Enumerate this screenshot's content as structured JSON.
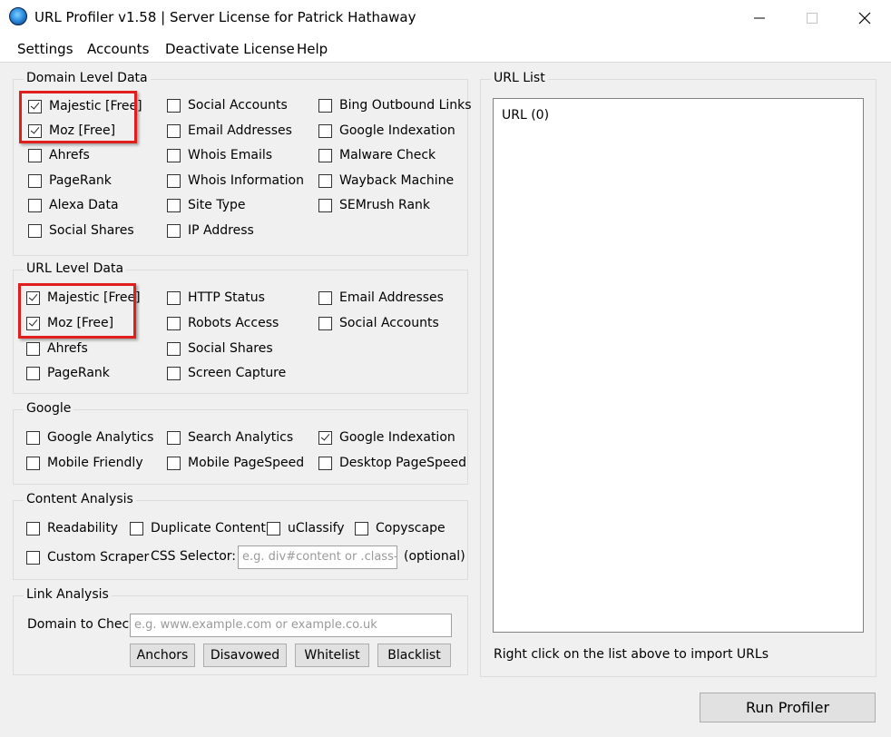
{
  "window": {
    "title": "URL Profiler v1.58 | Server License for Patrick Hathaway"
  },
  "menu": [
    "Settings",
    "Accounts",
    "Deactivate License",
    "Help"
  ],
  "domain_level": {
    "title": "Domain Level Data",
    "items": [
      {
        "label": "Majestic [Free]",
        "checked": true
      },
      {
        "label": "Moz [Free]",
        "checked": true
      },
      {
        "label": "Ahrefs",
        "checked": false
      },
      {
        "label": "PageRank",
        "checked": false
      },
      {
        "label": "Alexa Data",
        "checked": false
      },
      {
        "label": "Social Shares",
        "checked": false
      },
      {
        "label": "Social Accounts",
        "checked": false
      },
      {
        "label": "Email Addresses",
        "checked": false
      },
      {
        "label": "Whois Emails",
        "checked": false
      },
      {
        "label": "Whois Information",
        "checked": false
      },
      {
        "label": "Site Type",
        "checked": false
      },
      {
        "label": "IP Address",
        "checked": false
      },
      {
        "label": "Bing Outbound Links",
        "checked": false
      },
      {
        "label": "Google Indexation",
        "checked": false
      },
      {
        "label": "Malware Check",
        "checked": false
      },
      {
        "label": "Wayback Machine",
        "checked": false
      },
      {
        "label": "SEMrush Rank",
        "checked": false
      }
    ]
  },
  "url_level": {
    "title": "URL Level Data",
    "items": [
      {
        "label": "Majestic [Free]",
        "checked": true
      },
      {
        "label": "Moz [Free]",
        "checked": true
      },
      {
        "label": "Ahrefs",
        "checked": false
      },
      {
        "label": "PageRank",
        "checked": false
      },
      {
        "label": "HTTP Status",
        "checked": false
      },
      {
        "label": "Robots Access",
        "checked": false
      },
      {
        "label": "Social Shares",
        "checked": false
      },
      {
        "label": "Screen Capture",
        "checked": false
      },
      {
        "label": "Email Addresses",
        "checked": false
      },
      {
        "label": "Social Accounts",
        "checked": false
      }
    ]
  },
  "google": {
    "title": "Google",
    "items": [
      {
        "label": "Google Analytics",
        "checked": false
      },
      {
        "label": "Mobile Friendly",
        "checked": false
      },
      {
        "label": "Search Analytics",
        "checked": false
      },
      {
        "label": "Mobile PageSpeed",
        "checked": false
      },
      {
        "label": "Google Indexation",
        "checked": true
      },
      {
        "label": "Desktop PageSpeed",
        "checked": false
      }
    ]
  },
  "content_analysis": {
    "title": "Content Analysis",
    "items": [
      {
        "label": "Readability",
        "checked": false
      },
      {
        "label": "Duplicate Content",
        "checked": false
      },
      {
        "label": "uClassify",
        "checked": false
      },
      {
        "label": "Copyscape",
        "checked": false
      },
      {
        "label": "Custom Scraper",
        "checked": false
      }
    ],
    "css_selector_label": "CSS Selector:",
    "css_selector_placeholder": "e.g. div#content or .class-na",
    "optional_label": "(optional)"
  },
  "link_analysis": {
    "title": "Link Analysis",
    "domain_label": "Domain to Check:",
    "domain_placeholder": "e.g. www.example.com or example.co.uk",
    "buttons": [
      "Anchors",
      "Disavowed",
      "Whitelist",
      "Blacklist"
    ]
  },
  "url_list": {
    "title": "URL List",
    "header": "URL (0)",
    "hint": "Right click on the list above to import URLs"
  },
  "run_button": "Run Profiler",
  "colors": {
    "highlight": "#e01e1e",
    "background": "#f0f0f0"
  }
}
